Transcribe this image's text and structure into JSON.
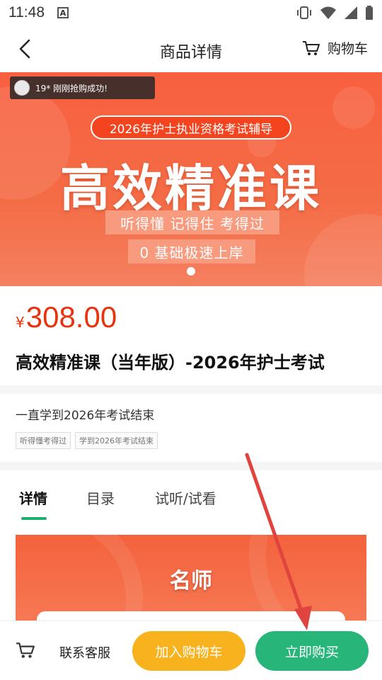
{
  "status_bar": {
    "time": "11:48",
    "a_badge": "A"
  },
  "nav": {
    "title": "商品详情",
    "cart_label": "购物车"
  },
  "banner": {
    "toast": "19* 刚刚抢购成功!",
    "pill": "2026年护士执业资格考试辅导",
    "headline": "高效精准课",
    "sub1": "听得懂 记得住 考得过",
    "sub2": "0 基础极速上岸"
  },
  "product": {
    "currency": "¥",
    "price": "308.00",
    "title": "高效精准课（当年版）-2026年护士考试",
    "description": "一直学到2026年考试结束",
    "tags": [
      "听得懂考得过",
      "学到2026年考试结束"
    ]
  },
  "tabs": [
    {
      "label": "详情",
      "active": true
    },
    {
      "label": "目录",
      "active": false
    },
    {
      "label": "试听/试看",
      "active": false
    }
  ],
  "detail": {
    "heading": "名师"
  },
  "bottom": {
    "service_label": "联系客服",
    "add_to_cart": "加入购物车",
    "buy_now": "立即购买"
  },
  "colors": {
    "accent_green": "#28b57a",
    "add_cart_yellow": "#f7b21e",
    "price_red": "#e8330f",
    "banner_orange": "#f8603f",
    "annotation_arrow": "#e0443f"
  },
  "icons": [
    "back-arrow-icon",
    "cart-icon",
    "vibrate-icon",
    "wifi-icon",
    "signal-icon",
    "battery-icon"
  ]
}
